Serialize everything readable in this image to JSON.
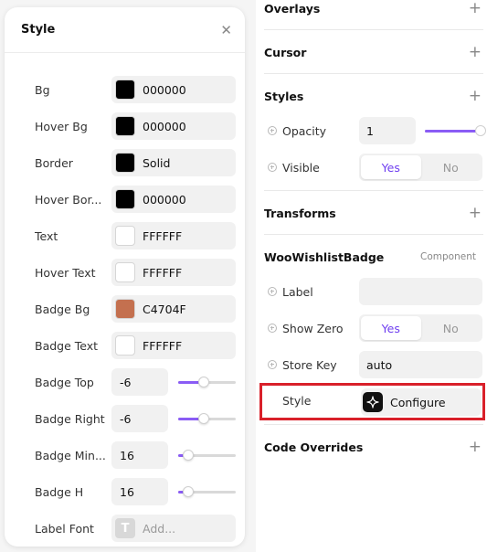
{
  "style_panel": {
    "title": "Style",
    "close_icon": "close-icon",
    "rows": [
      {
        "label": "Bg",
        "kind": "color",
        "color": "#000000",
        "value": "000000"
      },
      {
        "label": "Hover Bg",
        "kind": "color",
        "color": "#000000",
        "value": "000000"
      },
      {
        "label": "Border",
        "kind": "color",
        "color": "#000000",
        "value": "Solid"
      },
      {
        "label": "Hover Bor...",
        "kind": "color",
        "color": "#000000",
        "value": "000000"
      },
      {
        "label": "Text",
        "kind": "color",
        "color": "#FFFFFF",
        "value": "FFFFFF"
      },
      {
        "label": "Hover Text",
        "kind": "color",
        "color": "#FFFFFF",
        "value": "FFFFFF"
      },
      {
        "label": "Badge Bg",
        "kind": "color",
        "color": "#C4704F",
        "value": "C4704F"
      },
      {
        "label": "Badge Text",
        "kind": "color",
        "color": "#FFFFFF",
        "value": "FFFFFF"
      },
      {
        "label": "Badge Top",
        "kind": "number",
        "value": "-6",
        "slider": 0.45
      },
      {
        "label": "Badge Right",
        "kind": "number",
        "value": "-6",
        "slider": 0.45
      },
      {
        "label": "Badge Min...",
        "kind": "number",
        "value": "16",
        "slider": 0.18
      },
      {
        "label": "Badge H",
        "kind": "number",
        "value": "16",
        "slider": 0.18
      },
      {
        "label": "Label Font",
        "kind": "font",
        "placeholder": "Add...",
        "icon": "T"
      }
    ]
  },
  "props": {
    "overlays": "Overlays",
    "cursor": "Cursor",
    "styles": {
      "title": "Styles",
      "opacity_label": "Opacity",
      "opacity_value": "1",
      "opacity_slider": 1.0,
      "visible_label": "Visible",
      "visible_yes": "Yes",
      "visible_no": "No"
    },
    "transforms": "Transforms",
    "component": {
      "title": "WooWishlistBadge",
      "tag": "Component",
      "label_label": "Label",
      "label_value": "",
      "show_zero_label": "Show Zero",
      "show_zero_yes": "Yes",
      "show_zero_no": "No",
      "store_key_label": "Store Key",
      "store_key_value": "auto",
      "style_label": "Style",
      "configure_label": "Configure"
    },
    "code_overrides": "Code Overrides"
  },
  "colors": {
    "accent": "#8A5CF5",
    "accent_text": "#6F3FF0",
    "highlight": "#D9202A"
  }
}
